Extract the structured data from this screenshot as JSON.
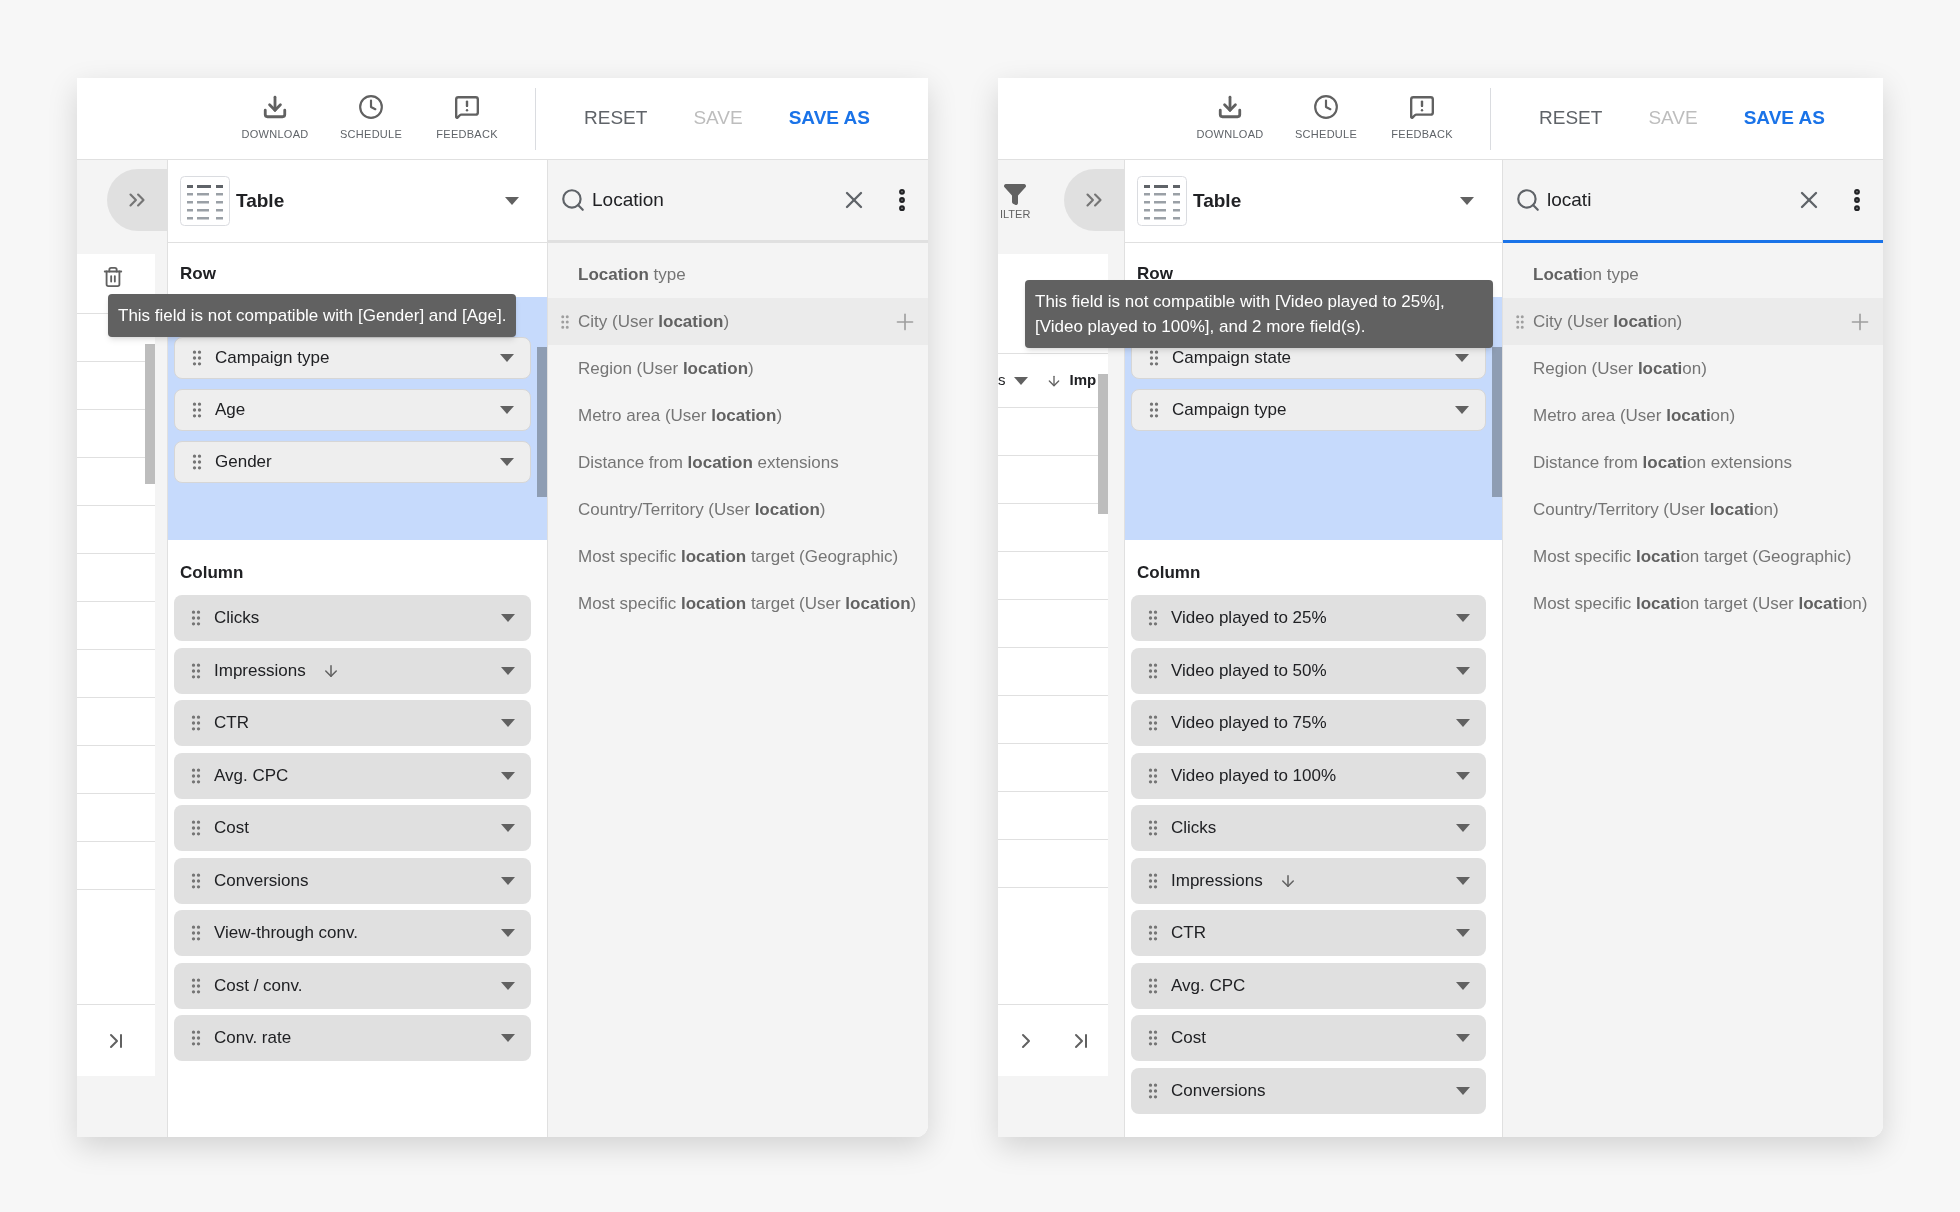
{
  "panels": [
    {
      "toolbar": {
        "actions": [
          {
            "label": "DOWNLOAD",
            "kind": "download"
          },
          {
            "label": "SCHEDULE",
            "kind": "schedule"
          },
          {
            "label": "FEEDBACK",
            "kind": "feedback"
          }
        ],
        "buttons": [
          {
            "label": "RESET",
            "kind": "text",
            "disabled": false
          },
          {
            "label": "SAVE",
            "kind": "text",
            "disabled": true
          },
          {
            "label": "SAVE AS",
            "kind": "primary",
            "disabled": false
          }
        ]
      },
      "side_strip": {
        "has_next": false
      },
      "chart_type": "Table",
      "search": {
        "value": "Location",
        "focused": false
      },
      "tooltip": "This field is not compatible with [Gender] and [Age].",
      "row_label": "Row",
      "row_fields": [
        "Campaign type",
        "Age",
        "Gender"
      ],
      "column_label": "Column",
      "column_fields": [
        {
          "label": "Clicks",
          "sorted": false
        },
        {
          "label": "Impressions",
          "sorted": true
        },
        {
          "label": "CTR",
          "sorted": false
        },
        {
          "label": "Avg. CPC",
          "sorted": false
        },
        {
          "label": "Cost",
          "sorted": false
        },
        {
          "label": "Conversions",
          "sorted": false
        },
        {
          "label": "View-through conv.",
          "sorted": false
        },
        {
          "label": "Cost / conv.",
          "sorted": false
        },
        {
          "label": "Conv. rate",
          "sorted": false
        }
      ],
      "results": [
        {
          "text": "**Location** type",
          "hovered": false
        },
        {
          "text": "City (User **location**)",
          "hovered": true
        },
        {
          "text": "Region (User **location**)",
          "hovered": false
        },
        {
          "text": "Metro area (User **location**)",
          "hovered": false
        },
        {
          "text": "Distance from **location** extensions",
          "hovered": false
        },
        {
          "text": "Country/Territory (User **location**)",
          "hovered": false
        },
        {
          "text": "Most specific **location** target (Geographic)",
          "hovered": false
        },
        {
          "text": "Most specific **location** target (User **location**)",
          "hovered": false
        }
      ]
    },
    {
      "toolbar": {
        "actions": [
          {
            "label": "DOWNLOAD",
            "kind": "download"
          },
          {
            "label": "SCHEDULE",
            "kind": "schedule"
          },
          {
            "label": "FEEDBACK",
            "kind": "feedback"
          }
        ],
        "buttons": [
          {
            "label": "RESET",
            "kind": "text",
            "disabled": false
          },
          {
            "label": "SAVE",
            "kind": "text",
            "disabled": true
          },
          {
            "label": "SAVE AS",
            "kind": "primary",
            "disabled": false
          }
        ]
      },
      "side_strip": {
        "filter_label": "ILTER",
        "table_header": [
          "s",
          "Imp"
        ],
        "has_next": true
      },
      "chart_type": "Table",
      "search": {
        "value": "locati",
        "focused": true
      },
      "tooltip": "This field is not compatible with [Video played to 25%], [Video played to 100%], and 2 more field(s).",
      "row_label": "Row",
      "row_fields": [
        "Campaign state",
        "Campaign type"
      ],
      "column_label": "Column",
      "column_fields": [
        {
          "label": "Video played to 25%",
          "sorted": false
        },
        {
          "label": "Video played to 50%",
          "sorted": false
        },
        {
          "label": "Video played to 75%",
          "sorted": false
        },
        {
          "label": "Video played to 100%",
          "sorted": false
        },
        {
          "label": "Clicks",
          "sorted": false
        },
        {
          "label": "Impressions",
          "sorted": true
        },
        {
          "label": "CTR",
          "sorted": false
        },
        {
          "label": "Avg. CPC",
          "sorted": false
        },
        {
          "label": "Cost",
          "sorted": false
        },
        {
          "label": "Conversions",
          "sorted": false
        }
      ],
      "results": [
        {
          "text": "**Locati**on type",
          "hovered": false
        },
        {
          "text": "City (User **locati**on)",
          "hovered": true
        },
        {
          "text": "Region (User **locati**on)",
          "hovered": false
        },
        {
          "text": "Metro area (User **locati**on)",
          "hovered": false
        },
        {
          "text": "Distance from **locati**on extensions",
          "hovered": false
        },
        {
          "text": "Country/Territory (User **locati**on)",
          "hovered": false
        },
        {
          "text": "Most specific **locati**on target (Geographic)",
          "hovered": false
        },
        {
          "text": "Most specific **locati**on target (User **locati**on)",
          "hovered": false
        }
      ]
    }
  ]
}
